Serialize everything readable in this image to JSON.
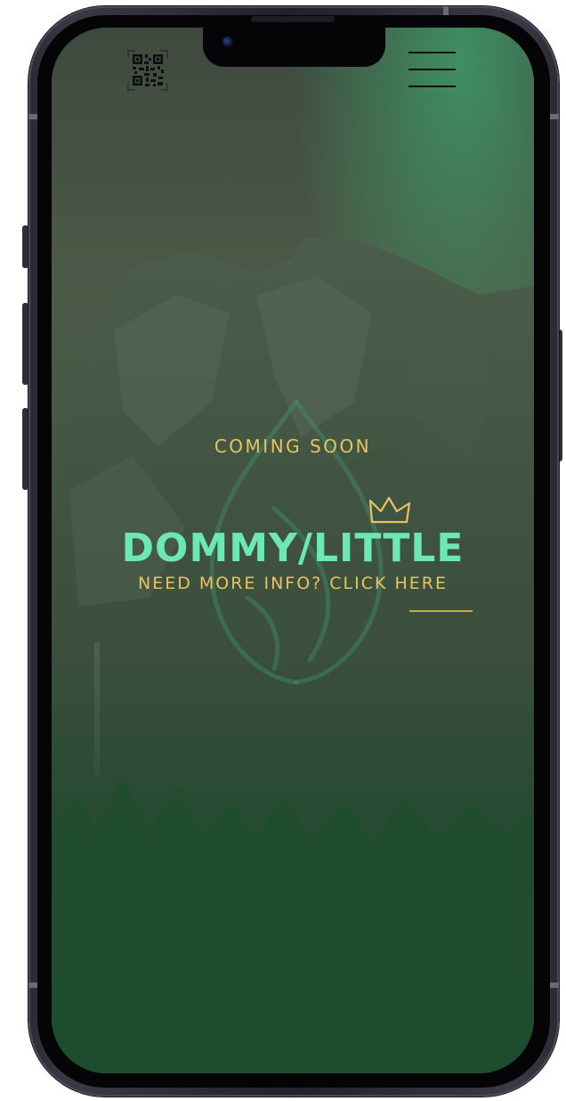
{
  "page": {
    "coming_soon": "COMING SOON",
    "brand": "DOMMY/LITTLE",
    "info_link": "NEED MORE INFO? CLICK HERE"
  },
  "icons": {
    "qr": "qr-code-icon",
    "menu": "hamburger-menu-icon",
    "crown": "crown-icon",
    "watermark": "leaf-drop-logo"
  },
  "colors": {
    "accent_gold": "#e8c45f",
    "brand_mint": "#6be8b5",
    "background_green": "#2f4a36"
  }
}
